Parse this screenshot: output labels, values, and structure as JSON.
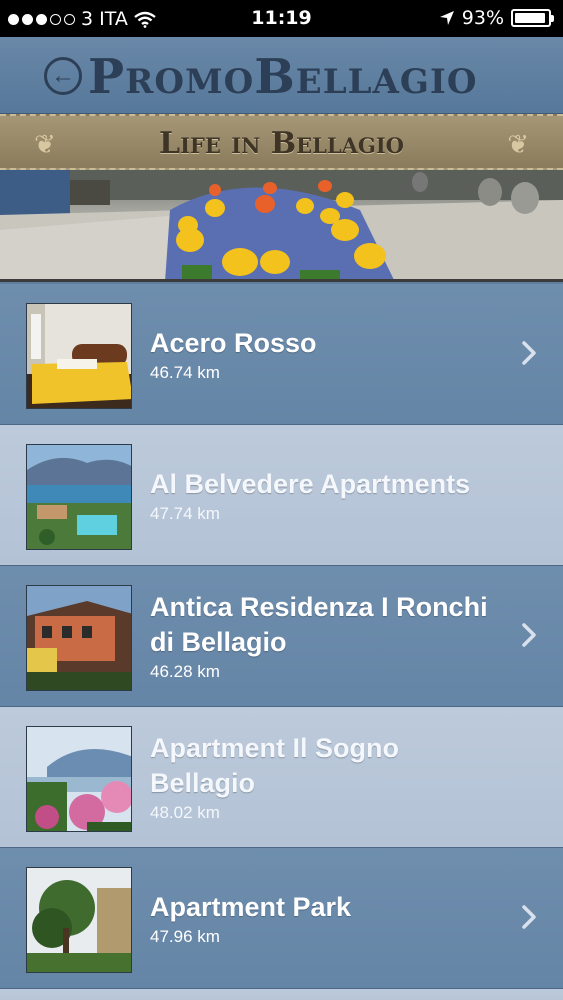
{
  "status_bar": {
    "carrier": "3 ITA",
    "time": "11:19",
    "battery": "93%",
    "battery_level": 0.93
  },
  "header": {
    "title": "PromoBellagio",
    "back_icon": "back-arrow-circle-icon"
  },
  "banner": {
    "title": "Life in Bellagio"
  },
  "list": {
    "items": [
      {
        "name": "Acero Rosso",
        "distance": "46.74 km"
      },
      {
        "name": "Al Belvedere Apartments",
        "distance": "47.74 km"
      },
      {
        "name": "Antica Residenza I Ronchi di Bellagio",
        "distance": "46.28 km"
      },
      {
        "name": "Apartment Il Sogno Bellagio",
        "distance": "48.02 km"
      },
      {
        "name": "Apartment Park",
        "distance": "47.96 km"
      }
    ]
  },
  "colors": {
    "row_dark": "#6a89aa",
    "row_light": "#b8c6d8",
    "header_text": "#2c3f57",
    "banner_bg": "#9a8b6b"
  }
}
